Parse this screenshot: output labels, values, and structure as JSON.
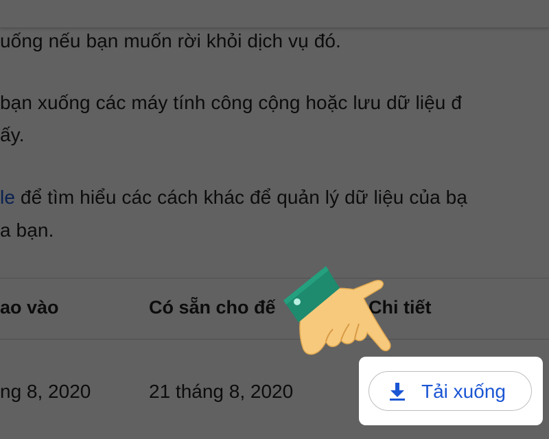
{
  "content": {
    "paragraphs": [
      "uống nếu bạn muốn rời khỏi dịch vụ đó.",
      "bạn xuống các máy tính công cộng hoặc lưu dữ liệu đ",
      "ấy.",
      "để tìm hiểu các cách khác để quản lý dữ liệu của bạ",
      "a bạn."
    ],
    "link_fragment": "le"
  },
  "table": {
    "headers": {
      "created": "ao vào",
      "available_until": "Có sẵn cho đế",
      "details": "Chi tiết"
    },
    "row": {
      "created": "ng 8, 2020",
      "available_until": "21 tháng 8, 2020"
    }
  },
  "download_button": {
    "label": "Tải xuống",
    "icon": "download-icon"
  },
  "annotation": {
    "icon": "pointing-hand-icon"
  },
  "colors": {
    "link": "#1a55d3",
    "button_text": "#1a55d3",
    "text": "#202124",
    "overlay": "rgba(0,0,0,0.62)",
    "cuff": "#1e8a6e",
    "skin": "#f7c97c"
  }
}
